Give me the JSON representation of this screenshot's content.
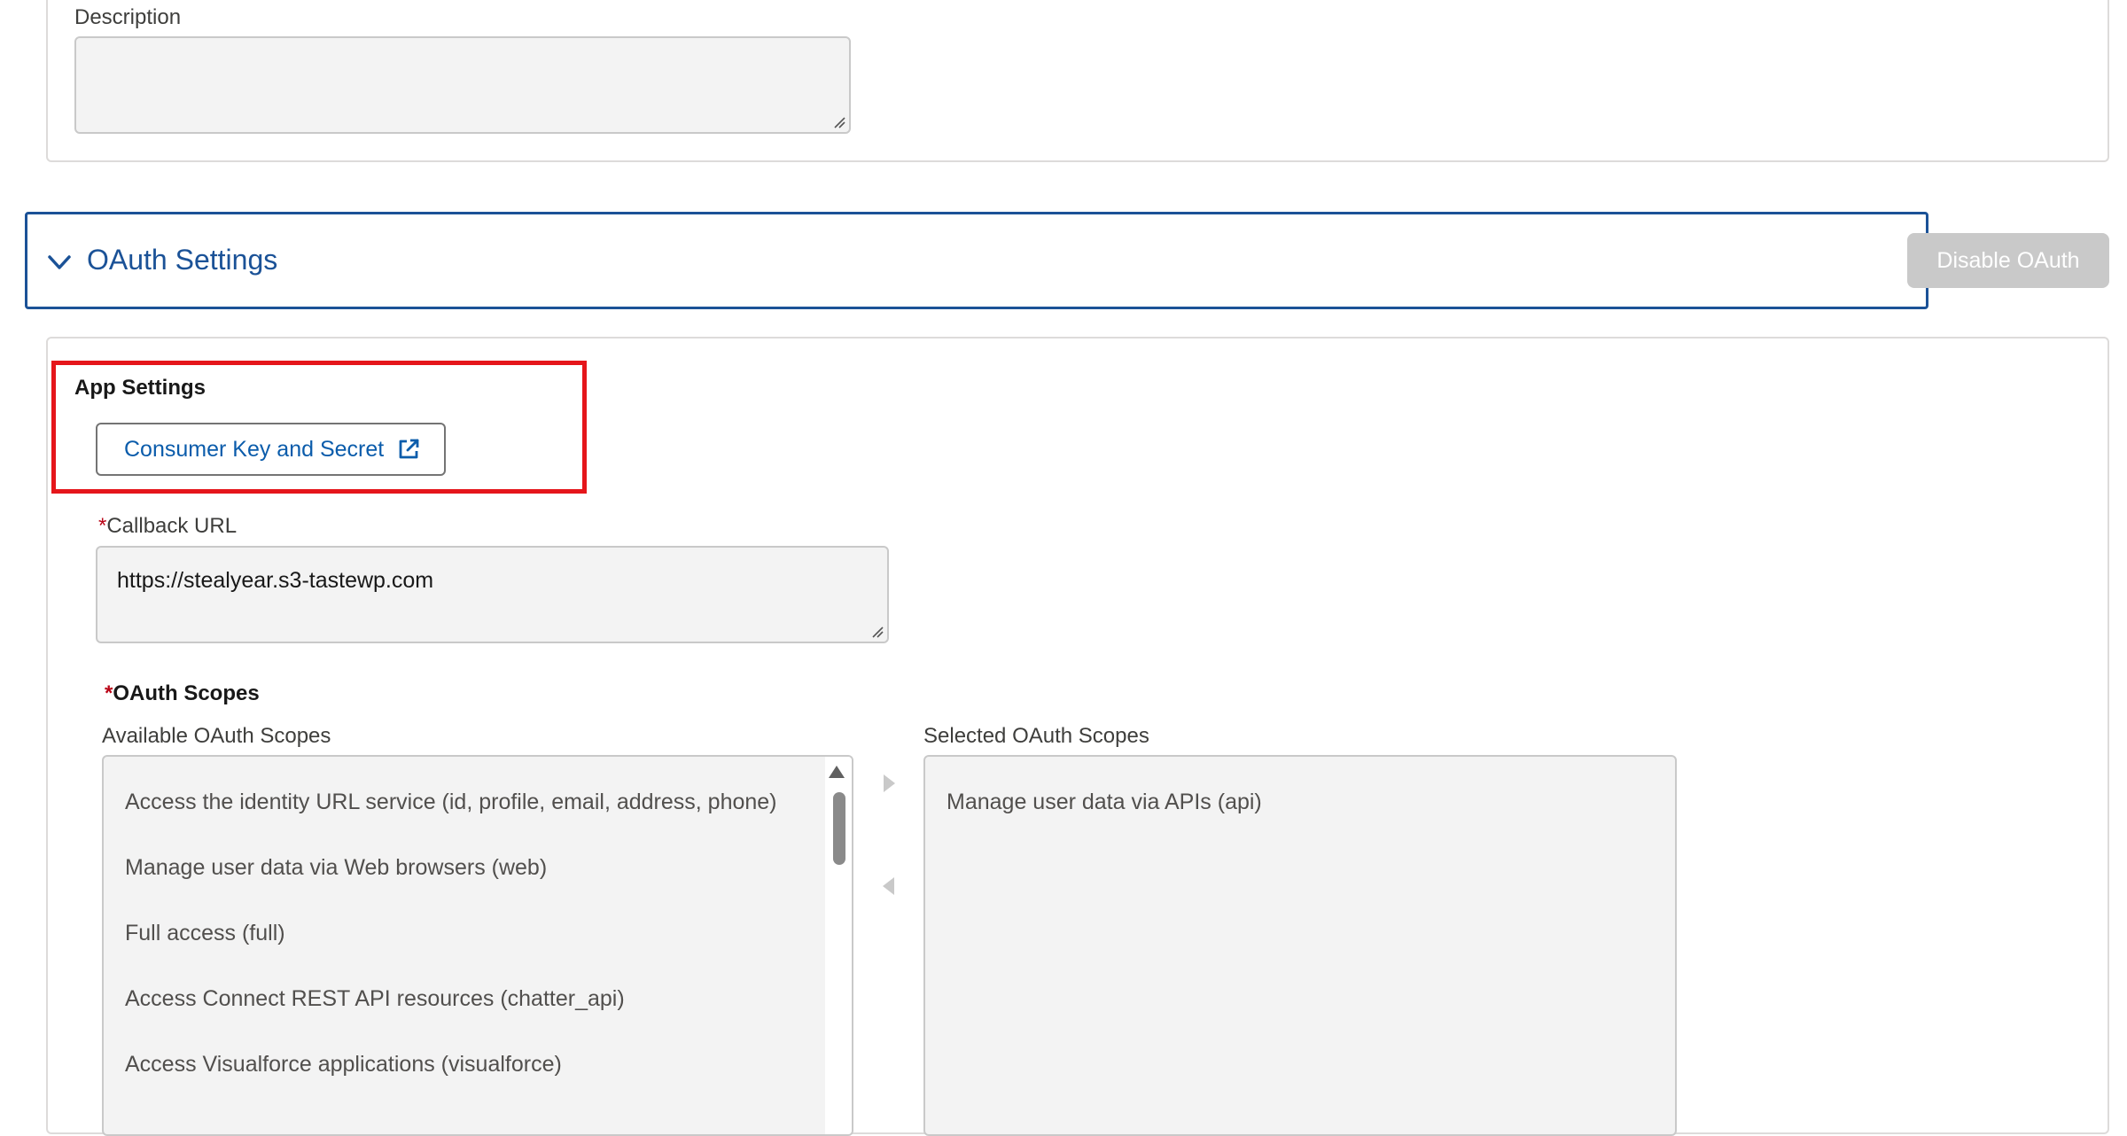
{
  "description": {
    "label": "Description",
    "value": ""
  },
  "oauth_section": {
    "title": "OAuth Settings",
    "disable_button": "Disable OAuth"
  },
  "app_settings": {
    "title": "App Settings",
    "consumer_button": "Consumer Key and Secret"
  },
  "callback": {
    "required_marker": "*",
    "label": "Callback URL",
    "value": "https://stealyear.s3-tastewp.com"
  },
  "scopes": {
    "required_marker": "*",
    "title": "OAuth Scopes",
    "available_label": "Available OAuth Scopes",
    "selected_label": "Selected OAuth Scopes",
    "available": [
      "Access the identity URL service (id, profile, email, address, phone)",
      "Manage user data via Web browsers (web)",
      "Full access (full)",
      "Access Connect REST API resources (chatter_api)",
      "Access Visualforce applications (visualforce)"
    ],
    "selected": [
      "Manage user data via APIs (api)"
    ]
  },
  "colors": {
    "section_border": "#1b5297",
    "link": "#0b5cab",
    "highlight": "#e5161b",
    "required": "#ba0517",
    "disabled_button": "#c9c9c9"
  }
}
